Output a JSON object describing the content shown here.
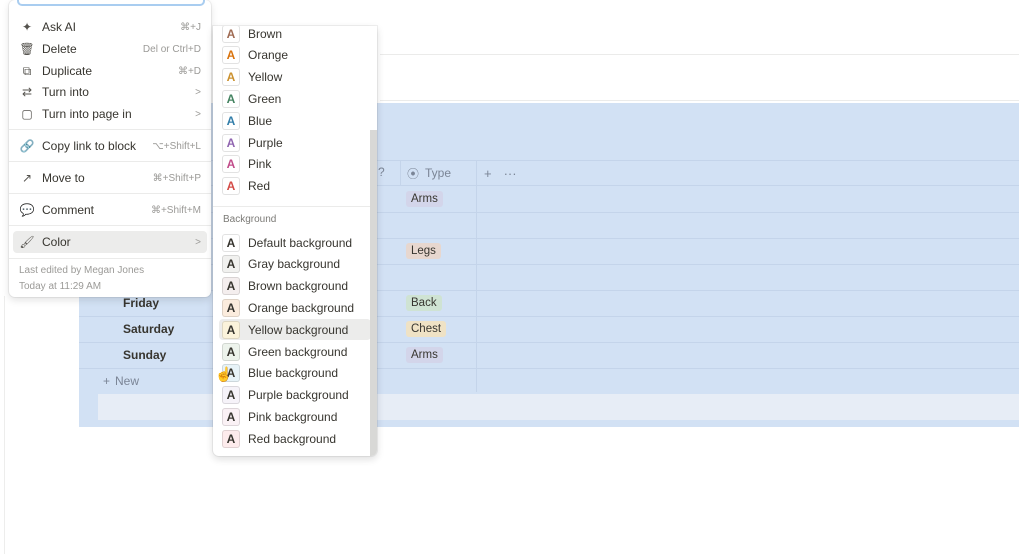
{
  "context_menu": {
    "items": [
      {
        "icon": "✦",
        "label": "Ask AI",
        "shortcut": "⌘+J"
      },
      {
        "icon": "🗑",
        "label": "Delete",
        "shortcut": "Del or Ctrl+D"
      },
      {
        "icon": "⧉",
        "label": "Duplicate",
        "shortcut": "⌘+D"
      },
      {
        "icon": "⇄",
        "label": "Turn into",
        "shortcut": ">"
      },
      {
        "icon": "▢",
        "label": "Turn into page in",
        "shortcut": ">"
      },
      {
        "icon": "🔗",
        "label": "Copy link to block",
        "shortcut": "⌥+Shift+L"
      },
      {
        "icon": "↗",
        "label": "Move to",
        "shortcut": "⌘+Shift+P"
      },
      {
        "icon": "💬",
        "label": "Comment",
        "shortcut": "⌘+Shift+M"
      },
      {
        "icon": "🖌",
        "label": "Color",
        "shortcut": ">"
      }
    ],
    "footer_line1": "Last edited by Megan Jones",
    "footer_line2": "Today at 11:29 AM"
  },
  "color_menu": {
    "text_colors": [
      {
        "label": "Brown",
        "color": "#9f6b53"
      },
      {
        "label": "Orange",
        "color": "#d9730d"
      },
      {
        "label": "Yellow",
        "color": "#cb912f"
      },
      {
        "label": "Green",
        "color": "#448361"
      },
      {
        "label": "Blue",
        "color": "#337ea9"
      },
      {
        "label": "Purple",
        "color": "#9065b0"
      },
      {
        "label": "Pink",
        "color": "#c14c8a"
      },
      {
        "label": "Red",
        "color": "#d44c47"
      }
    ],
    "background_title": "Background",
    "backgrounds": [
      {
        "label": "Default background",
        "bg": "#ffffff"
      },
      {
        "label": "Gray background",
        "bg": "#f1f1ef"
      },
      {
        "label": "Brown background",
        "bg": "#f4eeee"
      },
      {
        "label": "Orange background",
        "bg": "#fbecdd"
      },
      {
        "label": "Yellow background",
        "bg": "#fbf3db"
      },
      {
        "label": "Green background",
        "bg": "#edf3ec"
      },
      {
        "label": "Blue background",
        "bg": "#e7f3f8"
      },
      {
        "label": "Purple background",
        "bg": "#f6f3f9"
      },
      {
        "label": "Pink background",
        "bg": "#faf1f5"
      },
      {
        "label": "Red background",
        "bg": "#fdebec"
      }
    ],
    "glyph": "A"
  },
  "database": {
    "type_header": "Type",
    "type_header_icon": "⦿",
    "add_column": "+",
    "more": "···",
    "hidden_header_fragment": "?",
    "rows": [
      {
        "day": "",
        "tag": "Arms",
        "tag_color": "#d3d5ea"
      },
      {
        "day": "",
        "tag": "",
        "tag_color": ""
      },
      {
        "day": "",
        "tag": "Legs",
        "tag_color": "#e7d7cf"
      },
      {
        "day": "",
        "tag": "",
        "tag_color": ""
      },
      {
        "day": "Friday",
        "tag": "Back",
        "tag_color": "#cfe3d3"
      },
      {
        "day": "Saturday",
        "tag": "Chest",
        "tag_color": "#efe2c5"
      },
      {
        "day": "Sunday",
        "tag": "Arms",
        "tag_color": "#d3d5ea"
      }
    ],
    "new_label": "New",
    "new_icon": "+"
  }
}
